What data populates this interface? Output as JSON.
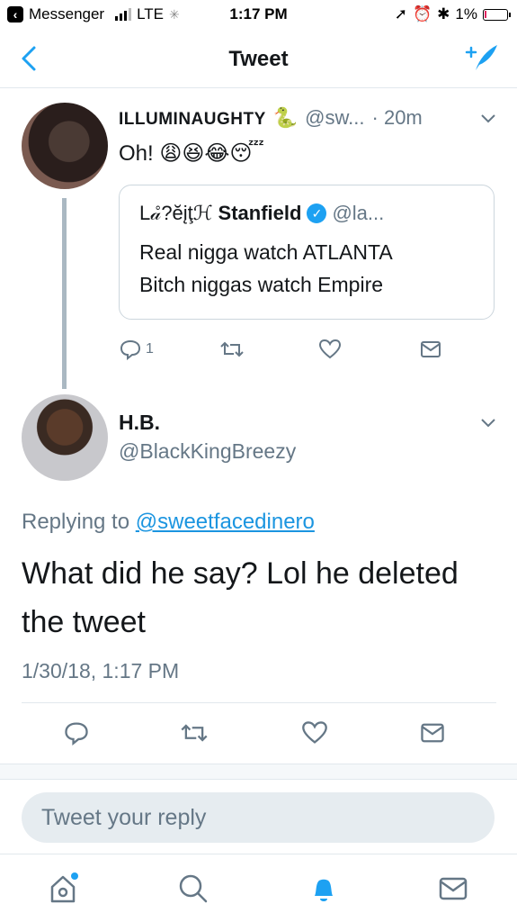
{
  "status_bar": {
    "back_app": "Messenger",
    "carrier": "LTE",
    "time": "1:17 PM",
    "battery": "1%"
  },
  "nav": {
    "title": "Tweet",
    "back_icon": "chevron-left-icon",
    "compose_icon": "compose-tweet-icon"
  },
  "original_tweet": {
    "name": "ILLUMINAUGHTY",
    "name_emoji": "🐍",
    "handle": "@sw...",
    "time": "· 20m",
    "text": "Oh! 😩😆😂😴",
    "reply_count": "1",
    "quoted": {
      "name_stylized": "L𝒶̊?ĕįţℋ",
      "name": "Stanfield",
      "handle": "@la...",
      "line1": "Real nigga watch ATLANTA",
      "line2": "Bitch niggas watch Empire"
    }
  },
  "reply_tweet": {
    "name": "H.B.",
    "handle": "@BlackKingBreezy",
    "replying_label": "Replying to",
    "replying_to": "@sweetfacedinero",
    "text": "What did he say? Lol he deleted the tweet",
    "timestamp": "1/30/18, 1:17 PM"
  },
  "reply_box": {
    "placeholder": "Tweet your reply"
  },
  "tabs": [
    "home-icon",
    "search-icon",
    "notifications-icon",
    "messages-icon"
  ],
  "colors": {
    "accent": "#1da1f2",
    "link": "#1b95e0",
    "muted": "#657786"
  }
}
